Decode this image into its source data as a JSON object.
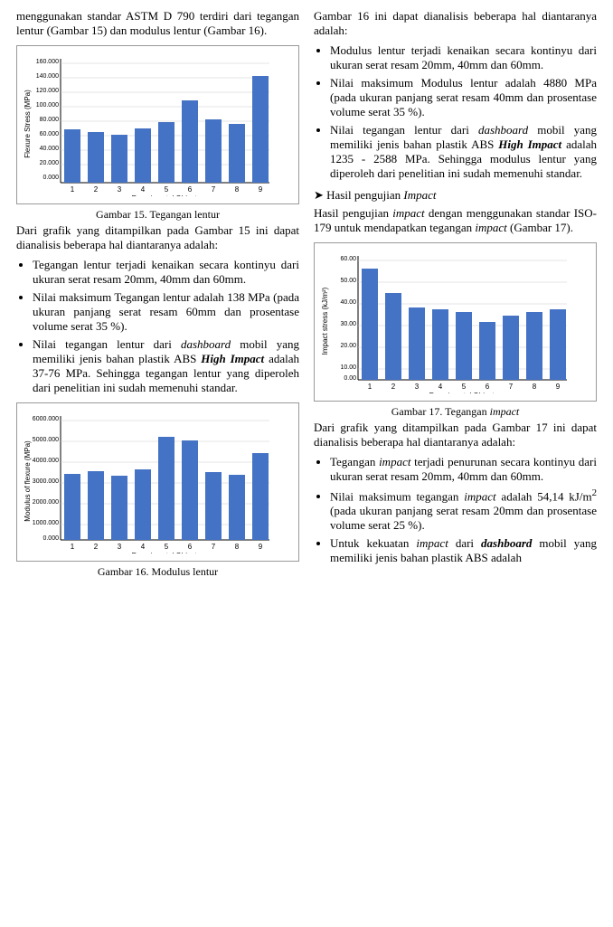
{
  "left": {
    "intro_text": "menggunakan standar ASTM D 790 terdiri dari tegangan lentur (Gambar 15) dan modulus lentur (Gambar 16).",
    "fig15_caption": "Gambar 15. Tegangan lentur",
    "fig15_ylabel": "Flexure Stress (MPa)",
    "fig15_xlabel": "Experimental Objects",
    "fig15_yticks": [
      "160.000",
      "140.000",
      "120.000",
      "100.000",
      "80.000",
      "60.000",
      "40.000",
      "20.000",
      "0.000"
    ],
    "fig15_bars": [
      68,
      65,
      62,
      70,
      78,
      105,
      82,
      75,
      138
    ],
    "analysis15_intro": "Dari grafik yang ditampilkan pada Gambar 15 ini dapat dianalisis beberapa hal diantaranya adalah:",
    "analysis15_items": [
      "Tegangan lentur terjadi kenaikan secara kontinyu dari ukuran serat resam 20mm, 40mm dan 60mm.",
      "Nilai maksimum Tegangan lentur adalah 138 MPa (pada ukuran panjang serat resam 60mm dan prosentase volume serat 35 %).",
      "Nilai tegangan lentur dari dashboard mobil yang memiliki jenis bahan plastik ABS High Impact adalah 37-76 MPa. Sehingga tegangan lentur yang diperoleh dari penelitian ini sudah memenuhi standar."
    ],
    "fig16_caption": "Gambar 16. Modulus lentur",
    "fig16_ylabel": "Modulus of flexure (MPa)",
    "fig16_xlabel": "Experimental Objects",
    "fig16_yticks": [
      "6000.000",
      "5000.000",
      "4000.000",
      "3000.000",
      "2000.000",
      "1000.000",
      "0.000"
    ],
    "fig16_bars": [
      3200,
      3350,
      3100,
      3400,
      5000,
      4800,
      3300,
      3150,
      4200
    ]
  },
  "right": {
    "analysis16_intro": "Gambar 16 ini dapat dianalisis beberapa hal diantaranya adalah:",
    "analysis16_items": [
      "Modulus lentur terjadi kenaikan secara kontinyu dari ukuran serat resam 20mm, 40mm dan 60mm.",
      "Nilai maksimum Modulus lentur adalah 4880 MPa (pada ukuran panjang serat resam 40mm dan prosentase volume serat 35 %).",
      "Nilai tegangan lentur dari dashboard mobil yang memiliki jenis bahan plastik ABS High Impact adalah 1235 - 2588 MPa. Sehingga modulus lentur yang diperoleh dari penelitian ini sudah memenuhi standar."
    ],
    "impact_heading": "Hasil pengujian Impact",
    "impact_intro": "Hasil pengujian impact dengan menggunakan standar ISO-179 untuk mendapatkan tegangan impact (Gambar 17).",
    "fig17_caption": "Gambar 17. Tegangan impact",
    "fig17_ylabel": "Impact stress (kJ/m²)",
    "fig17_xlabel": "Experimental Objects",
    "fig17_yticks": [
      "60.00",
      "50.00",
      "40.00",
      "30.00",
      "20.00",
      "10.00",
      "0.00"
    ],
    "fig17_bars": [
      54,
      42,
      35,
      34,
      33,
      28,
      31,
      33,
      34
    ],
    "analysis17_intro": "Dari grafik yang ditampilkan pada Gambar 17 ini dapat dianalisis beberapa hal diantaranya adalah:",
    "analysis17_items": [
      "Tegangan impact terjadi penurunan secara kontinyu dari ukuran serat resam 20mm, 40mm dan 60mm.",
      "Nilai maksimum tegangan impact adalah 54,14 kJ/m² (pada ukuran panjang serat resam 20mm dan prosentase volume serat 25 %).",
      "Untuk kekuatan impact dari dashboard mobil yang memiliki jenis bahan plastik ABS adalah"
    ]
  }
}
